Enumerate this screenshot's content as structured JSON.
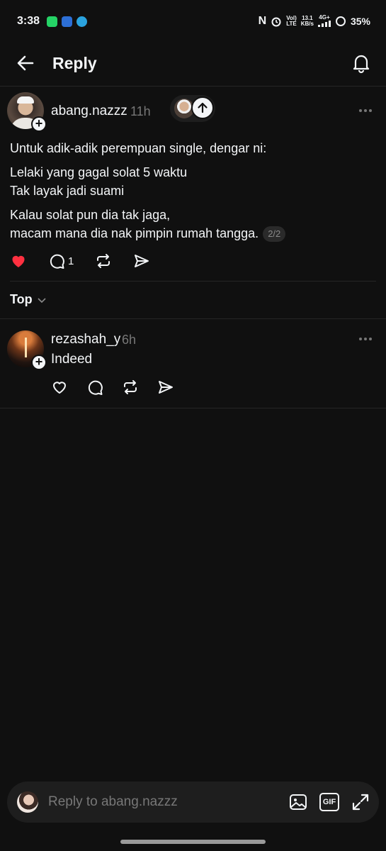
{
  "status_bar": {
    "time": "3:38",
    "volte_line1": "Vol)",
    "volte_line2": "LTE",
    "speed_line1": "13.1",
    "speed_line2": "KB/s",
    "network": "4G+",
    "battery": "35%"
  },
  "header": {
    "title": "Reply"
  },
  "post": {
    "username": "abang.nazzz",
    "time": "11h",
    "paragraphs": [
      "Untuk adik-adik perempuan single, dengar ni:",
      "Lelaki yang gagal solat 5 waktu",
      "Tak layak jadi suami",
      "Kalau solat pun dia tak jaga,",
      "macam mana dia nak pimpin rumah tangga."
    ],
    "page_indicator": "2/2",
    "liked": true,
    "reply_count": "1"
  },
  "sort": {
    "label": "Top"
  },
  "reply": {
    "username": "rezashah_y",
    "time": "6h",
    "text": "Indeed"
  },
  "composer": {
    "placeholder": "Reply to abang.nazzz",
    "gif_label": "GIF"
  },
  "colors": {
    "background": "#101010",
    "text": "#f3f5f7",
    "muted": "#777777",
    "like": "#ff3040"
  }
}
